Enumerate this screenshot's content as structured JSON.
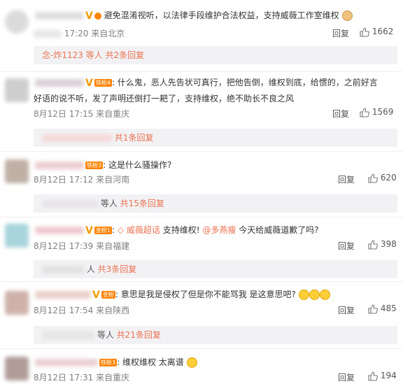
{
  "comments": [
    {
      "text": "避免混淆视听，以法律手段维护合法权益，支持威薇工作室维权",
      "date": "17:20",
      "location": "来自北京",
      "reply_label": "回复",
      "likes": "1662",
      "replies_prefix": "念-炸1123 等人",
      "replies_more": "共2条回复"
    },
    {
      "fan_level": "铁粉4",
      "text_line1": "什么鬼，恶人先告状可真行，把他告倒，维权到底，给惯的，之前好言",
      "text_line2": "好语的说不听，发了声明还倒打一耙了，支持维权，绝不助长不良之风",
      "date": "8月12日 17:15",
      "location": "来自重庆",
      "reply_label": "回复",
      "likes": "1569",
      "replies_more": "共1条回复"
    },
    {
      "fan_level": "铁粉3",
      "text": "这是什么骚操作?",
      "date": "8月12日 17:12",
      "location": "来自河南",
      "reply_label": "回复",
      "likes": "620",
      "replies_prefix": "等人",
      "replies_more": "共15条回复"
    },
    {
      "fan_level": "金粉1",
      "topic": "威薇超话",
      "text_a": "支持维权!",
      "mention": "@多燕瘦",
      "text_b": "今天给威薇道歉了吗?",
      "date": "8月12日 17:39",
      "location": "来自福建",
      "reply_label": "回复",
      "likes": "398",
      "replies_prefix": "人",
      "replies_more": "共3条回复"
    },
    {
      "fan_level": "金粉",
      "text": "意思是我是侵权了但是你不能骂我 是这意思吧?",
      "date": "8月12日 17:54",
      "location": "来自陕西",
      "reply_label": "回复",
      "likes": "485",
      "replies_prefix": "等人",
      "replies_more": "共21条回复"
    },
    {
      "fan_level": "铁粉3",
      "text": "维权维权 太离谱",
      "date": "8月12日 17:31",
      "location": "来自重庆",
      "reply_label": "回复",
      "likes": "194"
    }
  ]
}
